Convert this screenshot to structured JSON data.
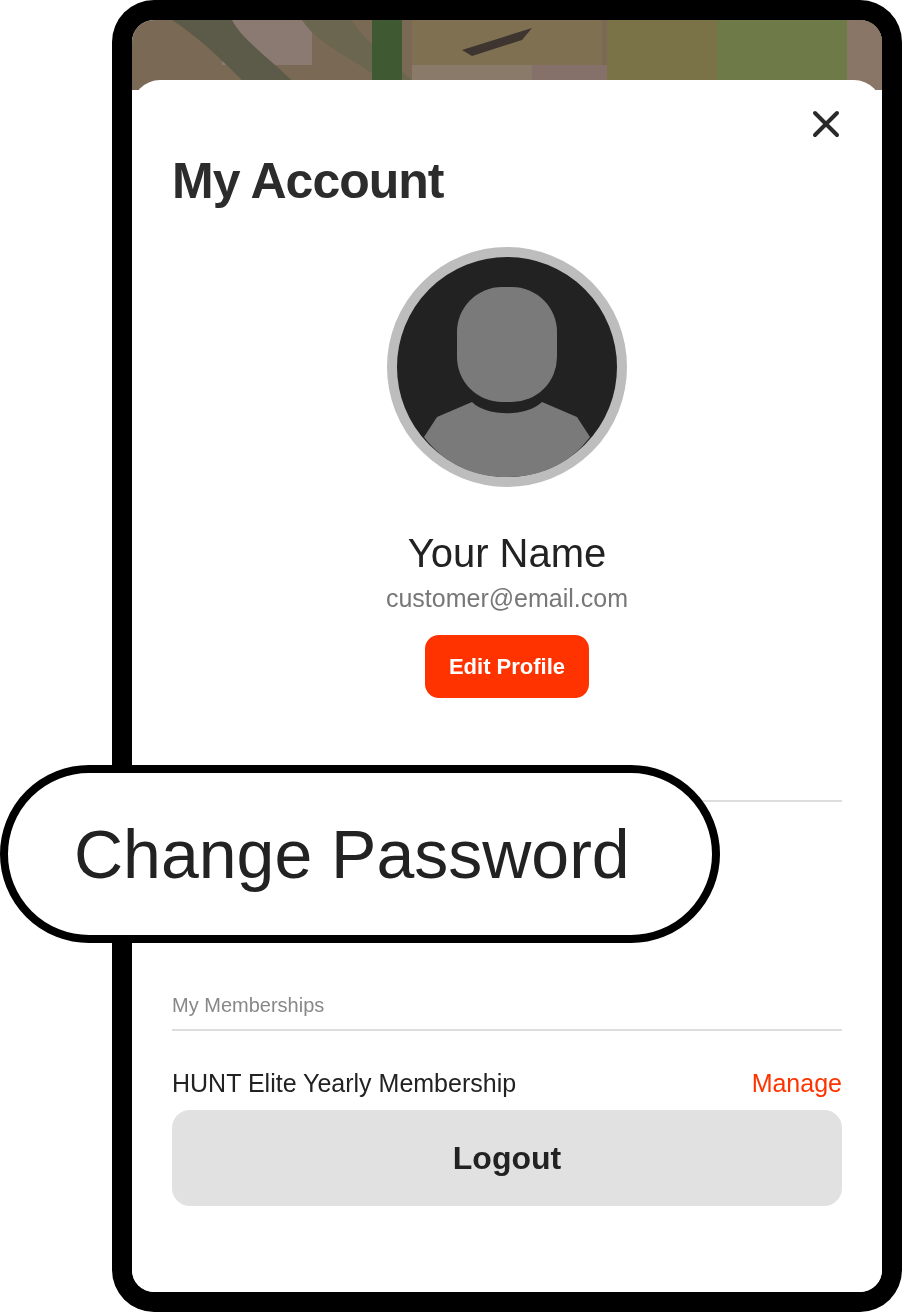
{
  "title": "My Account",
  "profile": {
    "name": "Your Name",
    "email": "customer@email.com",
    "edit_button": "Edit Profile"
  },
  "callout": {
    "label": "Change Password"
  },
  "memberships": {
    "heading": "My Memberships",
    "items": [
      {
        "name": "HUNT Elite Yearly Membership",
        "action": "Manage"
      }
    ]
  },
  "logout_button": "Logout"
}
